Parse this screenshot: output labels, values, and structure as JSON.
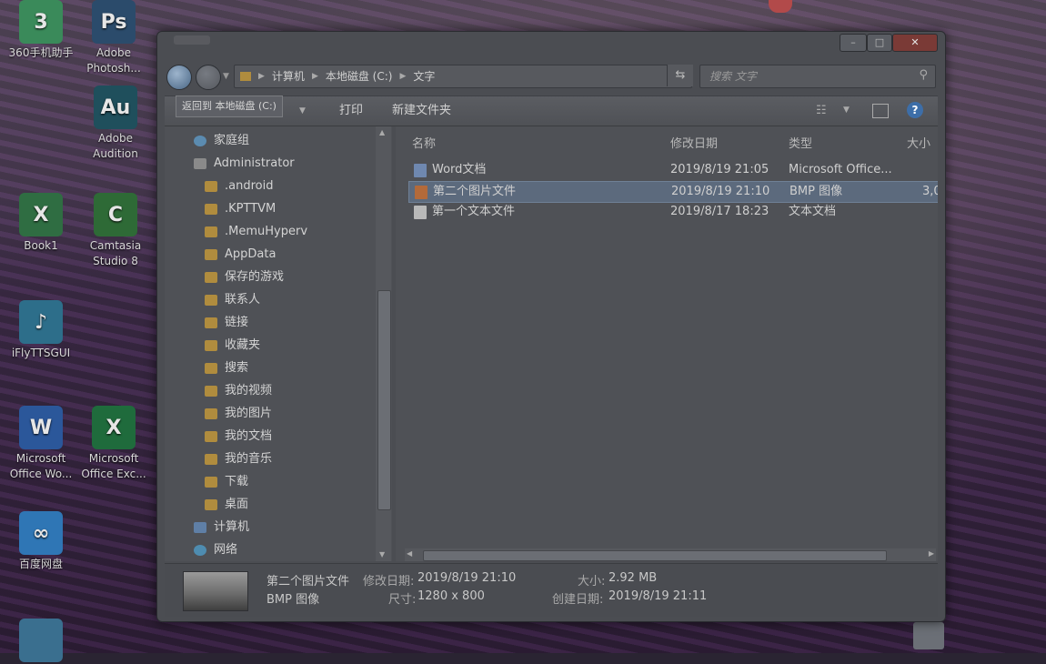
{
  "desktop": {
    "icons": [
      {
        "label": "360手机助手",
        "glyph": "3",
        "color": "#3a8a5a"
      },
      {
        "label": "Adobe\nPhotosh...",
        "glyph": "Ps",
        "color": "#2b4b6b"
      },
      {
        "label": "Adobe\nAudition",
        "glyph": "Au",
        "color": "#1f4f5c"
      },
      {
        "label": "Book1",
        "glyph": "X",
        "color": "#2f6d42"
      },
      {
        "label": "Camtasia\nStudio 8",
        "glyph": "C",
        "color": "#2e6a36"
      },
      {
        "label": "iFlyTTSGUI",
        "glyph": "♪",
        "color": "#2d6e8a"
      },
      {
        "label": "Microsoft\nOffice Wo...",
        "glyph": "W",
        "color": "#2b579a"
      },
      {
        "label": "Microsoft\nOffice Exc...",
        "glyph": "X",
        "color": "#1f6b3c"
      },
      {
        "label": "百度网盘",
        "glyph": "∞",
        "color": "#2f76b5"
      }
    ]
  },
  "window": {
    "address": {
      "segments": [
        "计算机",
        "本地磁盘 (C:)",
        "文字"
      ]
    },
    "search": {
      "placeholder": "搜索 文字"
    },
    "tooltip": "返回到 本地磁盘 (C:)",
    "toolbar": {
      "print": "打印",
      "new_folder": "新建文件夹"
    },
    "nav_tree": [
      {
        "label": "家庭组",
        "kind": "group",
        "indent": 0
      },
      {
        "label": "Administrator",
        "kind": "user",
        "indent": 0
      },
      {
        "label": ".android",
        "kind": "folder",
        "indent": 1
      },
      {
        "label": ".KPTTVM",
        "kind": "folder",
        "indent": 1
      },
      {
        "label": ".MemuHyperv",
        "kind": "folder",
        "indent": 1
      },
      {
        "label": "AppData",
        "kind": "folder",
        "indent": 1
      },
      {
        "label": "保存的游戏",
        "kind": "folder",
        "indent": 1
      },
      {
        "label": "联系人",
        "kind": "folder",
        "indent": 1
      },
      {
        "label": "链接",
        "kind": "folder",
        "indent": 1
      },
      {
        "label": "收藏夹",
        "kind": "folder",
        "indent": 1
      },
      {
        "label": "搜索",
        "kind": "folder",
        "indent": 1
      },
      {
        "label": "我的视频",
        "kind": "folder",
        "indent": 1
      },
      {
        "label": "我的图片",
        "kind": "folder",
        "indent": 1
      },
      {
        "label": "我的文档",
        "kind": "folder",
        "indent": 1
      },
      {
        "label": "我的音乐",
        "kind": "folder",
        "indent": 1
      },
      {
        "label": "下载",
        "kind": "folder",
        "indent": 1
      },
      {
        "label": "桌面",
        "kind": "folder",
        "indent": 1
      },
      {
        "label": "计算机",
        "kind": "pc",
        "indent": 0
      },
      {
        "label": "网络",
        "kind": "net",
        "indent": 0
      }
    ],
    "columns": {
      "name": "名称",
      "date": "修改日期",
      "type": "类型",
      "size": "大小"
    },
    "files": [
      {
        "name": "Word文档",
        "date": "2019/8/19 21:05",
        "type": "Microsoft Office...",
        "size": "",
        "icon": "word",
        "selected": false
      },
      {
        "name": "第二个图片文件",
        "date": "2019/8/19 21:10",
        "type": "BMP 图像",
        "size": "3,0",
        "icon": "bmp",
        "selected": true
      },
      {
        "name": "第一个文本文件",
        "date": "2019/8/17 18:23",
        "type": "文本文档",
        "size": "",
        "icon": "txt",
        "selected": false
      }
    ],
    "details": {
      "filename": "第二个图片文件",
      "filetype": "BMP 图像",
      "modified_label": "修改日期:",
      "modified": "2019/8/19 21:10",
      "size_label": "大小:",
      "size": "2.92 MB",
      "dims_label": "尺寸:",
      "dims": "1280 x 800",
      "created_label": "创建日期:",
      "created": "2019/8/19 21:11"
    }
  }
}
